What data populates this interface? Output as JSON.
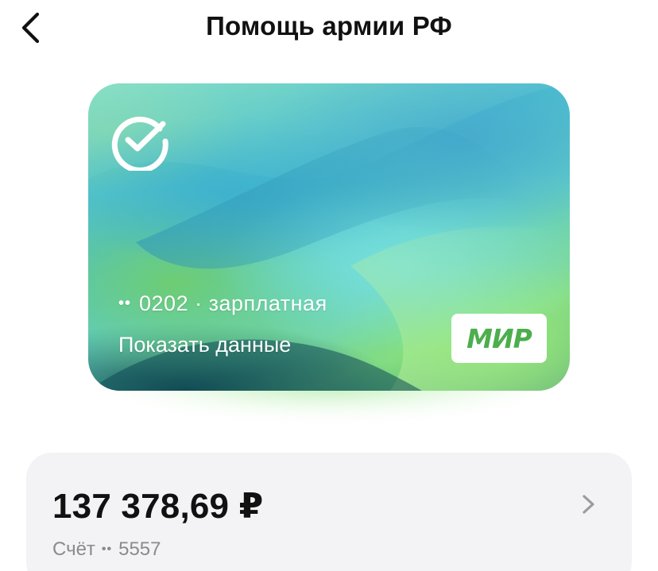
{
  "header": {
    "title": "Помощь армии РФ",
    "back_icon": "chevron-left-icon"
  },
  "card": {
    "bank_logo_icon": "sber-check-logo-icon",
    "masked_prefix": "••",
    "number_text": "0202 · зарплатная",
    "show_details_label": "Показать данные",
    "payment_system": "МИР",
    "colors": {
      "mir_green": "#4cae4c",
      "mir_blue": "#1a9fd8"
    }
  },
  "account": {
    "balance": "137 378,69 ₽",
    "label": "Счёт",
    "masked_prefix": "••",
    "number": "5557",
    "chevron_icon": "chevron-right-icon"
  }
}
